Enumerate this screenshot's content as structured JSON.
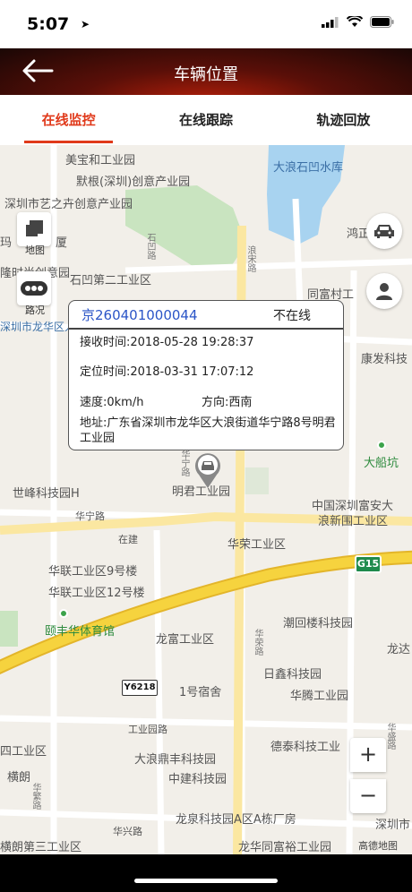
{
  "status_bar": {
    "time": "5:07",
    "location_icon": "location-arrow-icon"
  },
  "header": {
    "title": "车辆位置",
    "back_icon": "back-arrow-icon"
  },
  "tabs": [
    {
      "label": "在线监控",
      "active": true
    },
    {
      "label": "在线跟踪",
      "active": false
    },
    {
      "label": "轨迹回放",
      "active": false
    }
  ],
  "map": {
    "layer_button_label": "地图",
    "traffic_button_label": "路况",
    "zoom_in": "+",
    "zoom_out": "−",
    "road_sign_g15": "G15",
    "road_sign_y6218": "Y6218",
    "attribution": "高德地图",
    "labels": {
      "l1": "美宝和工业园",
      "l2": "默根(深圳)创意产业园",
      "l3": "深圳市艺之卉创意产业园",
      "l4": "大浪石凹水库",
      "l5": "石凹第二工业区",
      "l6": "鸿正",
      "l7": "玛",
      "l8": "厦",
      "l9": "隆时尚创意园",
      "l10": "同富村工",
      "l11": "深圳市龙华区人",
      "l12": "康发科技",
      "l13": "大船坑",
      "l14": "世峰科技园H",
      "l15": "明君工业园",
      "l16": "中国深圳富安大",
      "l17": "浪新围工业区",
      "l18": "华宁路",
      "l19": "在建",
      "l20": "华荣工业区",
      "l21": "华联工业区9号楼",
      "l22": "华联工业区12号楼",
      "l23": "潮回楼科技园",
      "l24": "颐丰华体育馆",
      "l25": "龙富工业区",
      "l26": "龙达",
      "l27": "日鑫科技园",
      "l28": "华腾工业园",
      "l29": "1号宿舍",
      "l30": "工业园路",
      "l31": "四工业区",
      "l32": "大浪鼎丰科技园",
      "l33": "德泰科技工业",
      "l34": "横朗",
      "l35": "中建科技园",
      "l36": "龙泉科技园A区A栋厂房",
      "l37": "深圳市",
      "l38": "华兴路",
      "l39": "龙华同富裕工业园",
      "l40": "横朗第三工业区",
      "l41": "华繁路",
      "l42": "华宁路",
      "l43": "石凹路",
      "l44": "浪宋路",
      "l45": "华荣路",
      "l46": "华盛路"
    }
  },
  "vehicle_popup": {
    "plate": "京260401000044",
    "status": "不在线",
    "received_time": "接收时间:2018-05-28 19:28:37",
    "position_time": "定位时间:2018-03-31 17:07:12",
    "speed": "速度:0km/h",
    "direction": "方向:西南",
    "address": "地址:广东省深圳市龙华区大浪街道华宁路8号明君工业园"
  },
  "colors": {
    "accent": "#e0391a",
    "plate": "#2b55c7",
    "water": "#a8d3f0",
    "park": "#c9e4c0",
    "highway": "#f6d33e"
  }
}
